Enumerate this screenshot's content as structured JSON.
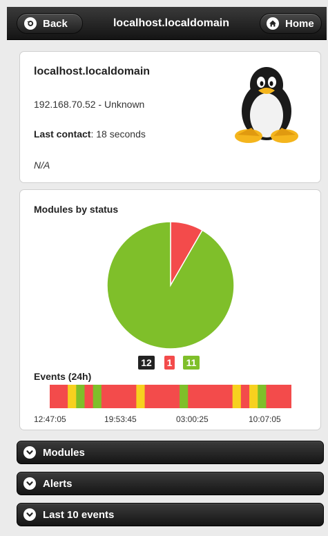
{
  "header": {
    "title": "localhost.localdomain",
    "back_label": "Back",
    "home_label": "Home"
  },
  "agent": {
    "name": "localhost.localdomain",
    "address": "192.168.70.52 - Unknown",
    "last_contact_label": "Last contact",
    "last_contact_value": ": 18 seconds",
    "description": "N/A",
    "os_icon": "linux-tux-icon"
  },
  "modules": {
    "title": "Modules by status",
    "legend": [
      {
        "value": "12",
        "color": "#222222"
      },
      {
        "value": "1",
        "color": "#f34b4b"
      },
      {
        "value": "11",
        "color": "#7fbf2a"
      }
    ]
  },
  "chart_data": [
    {
      "type": "pie",
      "title": "Modules by status",
      "slices": [
        {
          "value": 1,
          "color": "#f34b4b"
        },
        {
          "value": 11,
          "color": "#7fbf2a"
        }
      ]
    },
    {
      "type": "heatmap",
      "title": "Events (24h)",
      "tick_labels": [
        "12:47:05",
        "19:53:45",
        "03:00:25",
        "10:07:05"
      ],
      "colors": {
        "red": "#f34b4b",
        "yellow": "#f7d11f",
        "green": "#7fbf2a"
      },
      "segments": [
        {
          "color": "red",
          "width": 7.5
        },
        {
          "color": "yellow",
          "width": 3.5
        },
        {
          "color": "green",
          "width": 3.5
        },
        {
          "color": "red",
          "width": 3.5
        },
        {
          "color": "green",
          "width": 3.5
        },
        {
          "color": "red",
          "width": 14.5
        },
        {
          "color": "yellow",
          "width": 3.5
        },
        {
          "color": "red",
          "width": 14.5
        },
        {
          "color": "green",
          "width": 3.5
        },
        {
          "color": "red",
          "width": 18.5
        },
        {
          "color": "yellow",
          "width": 3.5
        },
        {
          "color": "red",
          "width": 3.5
        },
        {
          "color": "yellow",
          "width": 3.5
        },
        {
          "color": "green",
          "width": 3.5
        },
        {
          "color": "red",
          "width": 10.5
        }
      ]
    }
  ],
  "events": {
    "title": "Events (24h)"
  },
  "sections": [
    {
      "label": "Modules"
    },
    {
      "label": "Alerts"
    },
    {
      "label": "Last 10 events"
    }
  ]
}
